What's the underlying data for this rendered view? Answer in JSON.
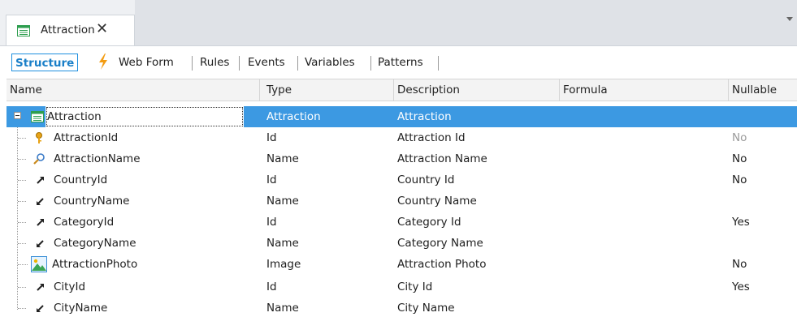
{
  "tab": {
    "title": "Attraction",
    "close_glyph": "✕"
  },
  "sections": [
    {
      "label": "Structure",
      "active": true
    },
    {
      "label": "Web Form",
      "active": false
    },
    {
      "label": "Rules",
      "active": false
    },
    {
      "label": "Events",
      "active": false
    },
    {
      "label": "Variables",
      "active": false
    },
    {
      "label": "Patterns",
      "active": false
    }
  ],
  "columns": {
    "name": "Name",
    "type": "Type",
    "description": "Description",
    "formula": "Formula",
    "nullable": "Nullable"
  },
  "root": {
    "name": "Attraction",
    "type": "Attraction",
    "description": "Attraction",
    "icon": "transaction-icon"
  },
  "rows": [
    {
      "name": "AttractionId",
      "type": "Id",
      "description": "Attraction Id",
      "nullable": "No",
      "icon": "key-icon"
    },
    {
      "name": "AttractionName",
      "type": "Name",
      "description": "Attraction Name",
      "nullable": "No",
      "icon": "description-icon"
    },
    {
      "name": "CountryId",
      "type": "Id",
      "description": "Country Id",
      "nullable": "No",
      "icon": "foreign-key-icon"
    },
    {
      "name": "CountryName",
      "type": "Name",
      "description": "Country Name",
      "nullable": "",
      "icon": "inferred-icon"
    },
    {
      "name": "CategoryId",
      "type": "Id",
      "description": "Category Id",
      "nullable": "Yes",
      "icon": "foreign-key-icon"
    },
    {
      "name": "CategoryName",
      "type": "Name",
      "description": "Category Name",
      "nullable": "",
      "icon": "inferred-icon"
    },
    {
      "name": "AttractionPhoto",
      "type": "Image",
      "description": "Attraction Photo",
      "nullable": "No",
      "icon": "image-icon"
    },
    {
      "name": "CityId",
      "type": "Id",
      "description": "City Id",
      "nullable": "Yes",
      "icon": "foreign-key-icon"
    },
    {
      "name": "CityName",
      "type": "Name",
      "description": "City Name",
      "nullable": "",
      "icon": "inferred-icon"
    }
  ],
  "colors": {
    "accent": "#1f8fdf",
    "selection": "#3c99e2",
    "bolt": "#f39c12"
  }
}
